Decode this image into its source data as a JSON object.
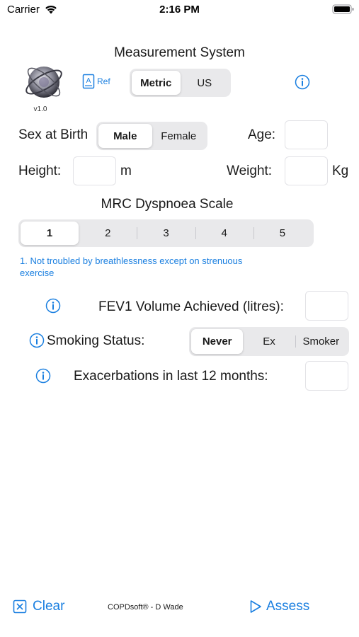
{
  "status_bar": {
    "carrier": "Carrier",
    "time": "2:16 PM"
  },
  "header": {
    "title": "Measurement System",
    "logo_version": "v1.0",
    "ref_label": "Ref",
    "units_options": [
      "Metric",
      "US"
    ],
    "units_selected": "Metric"
  },
  "sex": {
    "label": "Sex at Birth",
    "options": [
      "Male",
      "Female"
    ],
    "selected": "Male"
  },
  "age": {
    "label": "Age:",
    "value": ""
  },
  "height": {
    "label": "Height:",
    "value": "",
    "unit": "m"
  },
  "weight": {
    "label": "Weight:",
    "value": "",
    "unit": "Kg"
  },
  "dyspnoea": {
    "title": "MRC Dyspnoea Scale",
    "options": [
      "1",
      "2",
      "3",
      "4",
      "5"
    ],
    "selected": "1",
    "description": "1. Not troubled by breathlessness except on strenuous exercise"
  },
  "fev1": {
    "label": "FEV1 Volume Achieved (litres):",
    "value": ""
  },
  "smoking": {
    "label": "Smoking Status:",
    "options": [
      "Never",
      "Ex",
      "Smoker"
    ],
    "selected": "Never"
  },
  "exacerbations": {
    "label": "Exacerbations in last 12 months:",
    "value": ""
  },
  "footer": {
    "clear_label": "Clear",
    "credit": "COPDsoft® - D Wade",
    "assess_label": "Assess"
  },
  "colors": {
    "accent": "#1a7fe0",
    "segment_bg": "#e9e9eb"
  }
}
